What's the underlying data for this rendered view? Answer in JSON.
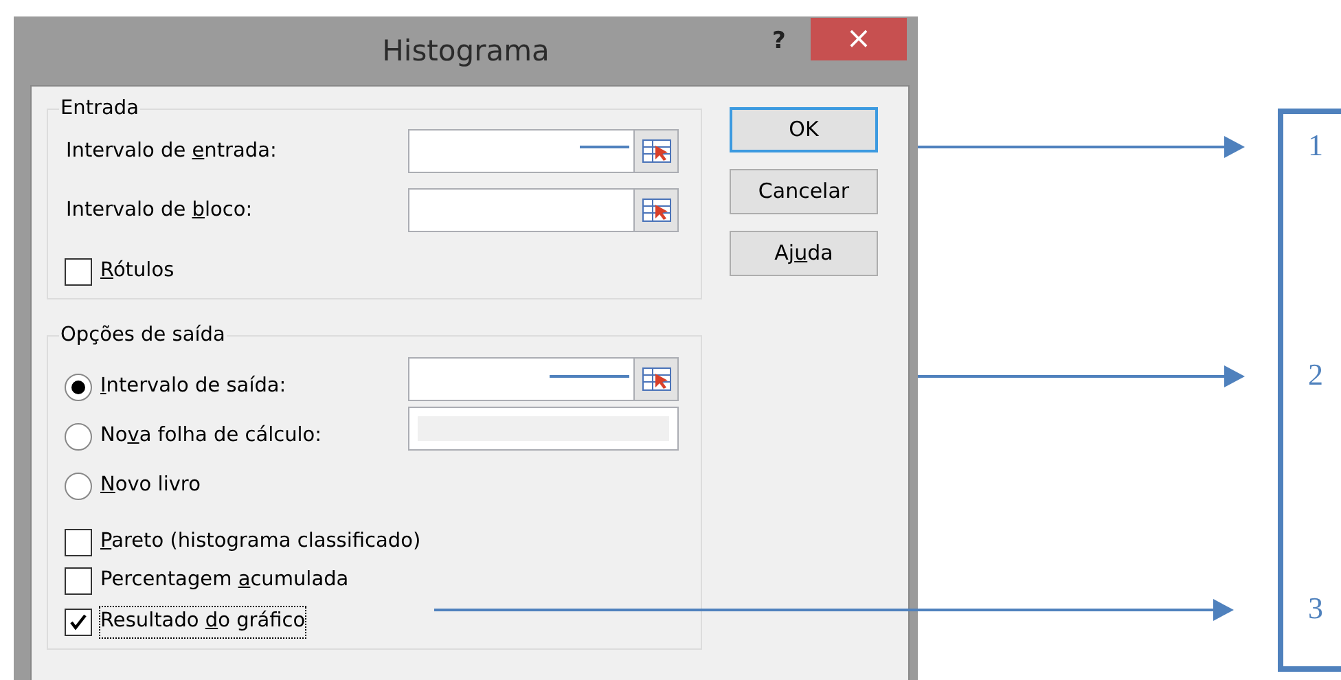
{
  "window": {
    "title": "Histograma",
    "help": "?",
    "close": "×"
  },
  "input_group": {
    "title": "Entrada",
    "fields": [
      {
        "label": {
          "before": "Intervalo de ",
          "key": "e",
          "after": "ntrada:"
        },
        "disabled": false
      },
      {
        "label": {
          "before": "Intervalo de ",
          "key": "b",
          "after": "loco:"
        },
        "disabled": false
      }
    ],
    "checkboxes": [
      {
        "label": {
          "key": "R",
          "after": "ótulos"
        },
        "checked": false,
        "focused": false
      }
    ]
  },
  "output_group": {
    "title": "Opções de saída",
    "radios": [
      {
        "label": {
          "key": "I",
          "after": "ntervalo de saída:"
        },
        "selected": true,
        "kind": "range"
      },
      {
        "label": {
          "before": "No",
          "key": "v",
          "after": "a folha de cálculo:"
        },
        "selected": false,
        "kind": "sheet"
      },
      {
        "label": {
          "key": "N",
          "after": "ovo livro"
        },
        "selected": false,
        "kind": "plain"
      }
    ],
    "checkboxes": [
      {
        "label": {
          "key": "P",
          "after": "areto (histograma classificado)"
        },
        "checked": false,
        "focused": false
      },
      {
        "label": {
          "before": "Percentagem ",
          "key": "a",
          "after": "cumulada"
        },
        "checked": false,
        "focused": false
      },
      {
        "label": {
          "before": "Resultado ",
          "key": "d",
          "after": "o gráfico"
        },
        "checked": true,
        "focused": true
      }
    ]
  },
  "buttons": [
    {
      "label": {
        "before": "OK"
      },
      "default": true
    },
    {
      "label": {
        "before": "Cancelar"
      },
      "default": false
    },
    {
      "label": {
        "before": "Aj",
        "key": "u",
        "after": "da"
      },
      "default": false
    }
  ],
  "annotations": [
    "1",
    "2",
    "3"
  ]
}
